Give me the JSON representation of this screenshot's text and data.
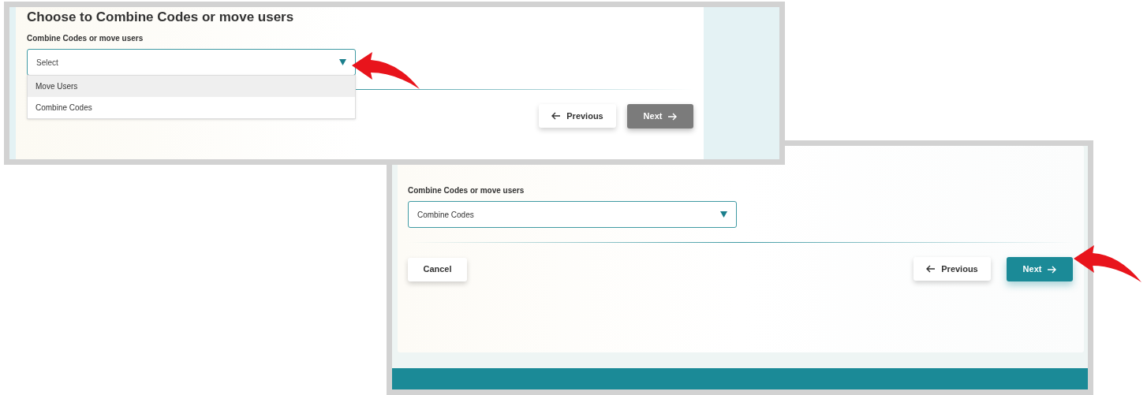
{
  "screenshots": [
    {
      "kind": "dropdown_open",
      "field_label": "Combine Codes or move users",
      "heading": "Choose to Combine Codes or move users",
      "select": {
        "placeholder": "Select"
      },
      "options": [
        {
          "label": "Move Users",
          "highlighted": true
        },
        {
          "label": "Combine Codes",
          "highlighted": false
        }
      ],
      "buttons": [
        {
          "kind": "previous",
          "label": "Previous"
        },
        {
          "kind": "next",
          "label": "Next",
          "disabled": true
        }
      ]
    },
    {
      "kind": "value_chosen",
      "field_label": "Combine Codes or move users",
      "select": {
        "value": "Combine Codes"
      },
      "buttons": [
        {
          "kind": "cancel",
          "label": "Cancel"
        },
        {
          "kind": "previous",
          "label": "Previous"
        },
        {
          "kind": "next",
          "label": "Next",
          "disabled": false
        }
      ]
    }
  ]
}
